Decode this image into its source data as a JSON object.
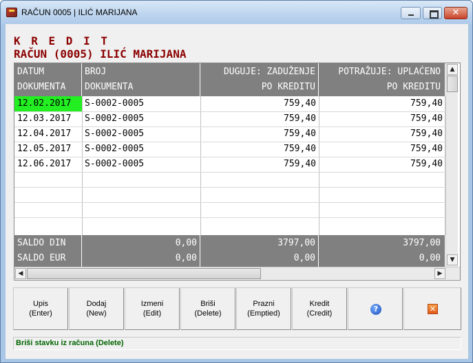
{
  "window": {
    "title": "RAČUN 0005 | ILIĆ MARIJANA",
    "close_glyph": "✕"
  },
  "heading": {
    "line1": "K R E D I T",
    "line2": "RAČUN (0005) ILIĆ MARIJANA"
  },
  "table": {
    "columns": [
      {
        "line1": "DATUM",
        "line2": "DOKUMENTA"
      },
      {
        "line1": "BROJ",
        "line2": "DOKUMENTA"
      },
      {
        "line1": "DUGUJE: ZADUŽENJE",
        "line2": "PO KREDITU"
      },
      {
        "line1": "POTRAŽUJE: UPLAĆENO",
        "line2": "PO KREDITU"
      }
    ],
    "rows": [
      {
        "date": "12.02.2017",
        "doc": "S-0002-0005",
        "duguje": "759,40",
        "potrazuje": "759,40"
      },
      {
        "date": "12.03.2017",
        "doc": "S-0002-0005",
        "duguje": "759,40",
        "potrazuje": "759,40"
      },
      {
        "date": "12.04.2017",
        "doc": "S-0002-0005",
        "duguje": "759,40",
        "potrazuje": "759,40"
      },
      {
        "date": "12.05.2017",
        "doc": "S-0002-0005",
        "duguje": "759,40",
        "potrazuje": "759,40"
      },
      {
        "date": "12.06.2017",
        "doc": "S-0002-0005",
        "duguje": "759,40",
        "potrazuje": "759,40"
      }
    ],
    "footer": [
      {
        "label": "SALDO DIN",
        "col2": "0,00",
        "duguje": "3797,00",
        "potrazuje": "3797,00"
      },
      {
        "label": "SALDO EUR",
        "col2": "0,00",
        "duguje": "0,00",
        "potrazuje": "0,00"
      }
    ],
    "selected_color": "#22ee22"
  },
  "scroll": {
    "up": "▲",
    "down": "▼",
    "left": "◀",
    "right": "▶"
  },
  "toolbar": {
    "buttons": [
      {
        "l1": "Upis",
        "l2": "(Enter)"
      },
      {
        "l1": "Dodaj",
        "l2": "(New)"
      },
      {
        "l1": "Izmeni",
        "l2": "(Edit)"
      },
      {
        "l1": "Briši",
        "l2": "(Delete)"
      },
      {
        "l1": "Prazni",
        "l2": "(Emptied)"
      },
      {
        "l1": "Kredit",
        "l2": "(Credit)"
      }
    ],
    "help_glyph": "?",
    "close_glyph": "✕",
    "help_icon": "help-icon",
    "close_icon": "close-icon"
  },
  "status": {
    "text": "Briši stavku iz računa (Delete)",
    "color": "#006400"
  }
}
